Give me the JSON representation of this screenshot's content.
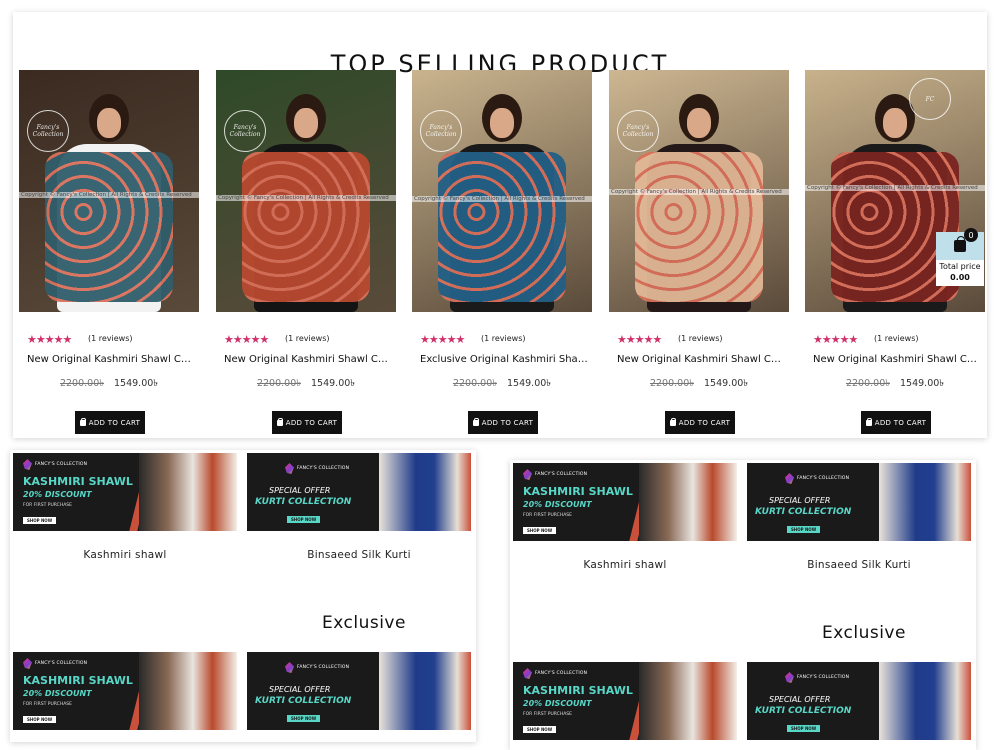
{
  "top_section": {
    "title": "TOP SELLING PRODUCT",
    "products": [
      {
        "rating_stars": "★★★★★",
        "reviews": "(1 reviews)",
        "name": "New Original Kashmiri Shawl Collection",
        "old_price": "2200.00৳",
        "price": "1549.00৳",
        "cart_label": "ADD TO CART",
        "copyright": "Copyright © Fancy's Collection | All Rights & Credits Reserved",
        "watermark": "Fancy's Collection",
        "colors": {
          "bg": "#3a2a20",
          "shawl": "#2f5d6a",
          "body": "#f2f2f2"
        }
      },
      {
        "rating_stars": "★★★★★",
        "reviews": "(1 reviews)",
        "name": "New Original Kashmiri Shawl Collection",
        "old_price": "2200.00৳",
        "price": "1549.00৳",
        "cart_label": "ADD TO CART",
        "copyright": "Copyright © Fancy's Collection | All Rights & Credits Reserved",
        "watermark": "Fancy's Collection",
        "colors": {
          "bg": "#2e4a28",
          "shawl": "#b8492f",
          "body": "#141414"
        }
      },
      {
        "rating_stars": "★★★★★",
        "reviews": "(1 reviews)",
        "name": "Exclusive Original Kashmiri Shawl Collection",
        "old_price": "2200.00৳",
        "price": "1549.00৳",
        "cart_label": "ADD TO CART",
        "copyright": "Copyright © Fancy's Collection | All Rights & Credits Reserved",
        "watermark": "Fancy's Collection",
        "colors": {
          "bg": "#c9b48e",
          "shawl": "#225f85",
          "body": "#1a1a1a"
        }
      },
      {
        "rating_stars": "★★★★★",
        "reviews": "(1 reviews)",
        "name": "New Original Kashmiri Shawl Collection",
        "old_price": "2200.00৳",
        "price": "1549.00৳",
        "cart_label": "ADD TO CART",
        "copyright": "Copyright © Fancy's Collection | All Rights & Credits Reserved",
        "watermark": "Fancy's Collection",
        "colors": {
          "bg": "#cdb792",
          "shawl": "#e2b896",
          "body": "#241818"
        }
      },
      {
        "rating_stars": "★★★★★",
        "reviews": "(1 reviews)",
        "name": "New Original Kashmiri Shawl Collection",
        "old_price": "2200.00৳",
        "price": "1549.00৳",
        "cart_label": "ADD TO CART",
        "copyright": "Copyright © Fancy's Collection | All Rights & Credits Reserved",
        "watermark": "FC",
        "colors": {
          "bg": "#c8b28c",
          "shawl": "#7a2420",
          "body": "#1a1a1a"
        }
      }
    ]
  },
  "cart_widget": {
    "count": "0",
    "total_label": "Total price",
    "total_value": "0.00",
    "icon": "shopping-bag-icon"
  },
  "banners": {
    "logo_text": "FANCY'S COLLECTION",
    "kashmiri": {
      "line1": "KASHMIRI SHAWL",
      "line2": "20% DISCOUNT",
      "line3": "FOR FIRST PURCHASE",
      "button": "SHOP NOW",
      "caption": "Kashmiri shawl"
    },
    "kurti": {
      "line1": "SPECIAL OFFER",
      "line2": "KURTI COLLECTION",
      "button": "SHOP NOW",
      "caption": "Binsaeed Silk Kurti"
    },
    "exclusive_heading": "Exclusive"
  },
  "colors": {
    "star": "#d0306a",
    "banner_bg": "#1a1a1a",
    "banner_accent": "#58d6c6",
    "banner_red": "#c9513b",
    "cart_box": "#bfe0ea"
  }
}
